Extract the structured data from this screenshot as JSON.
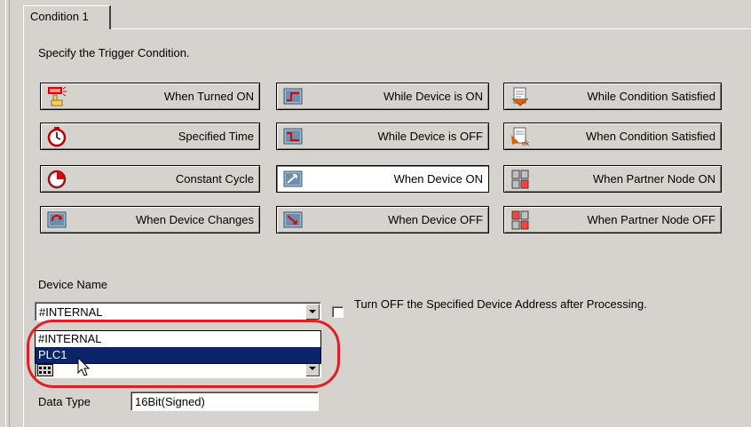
{
  "tab": {
    "label": "Condition 1"
  },
  "instruction": "Specify the Trigger Condition.",
  "trigger_buttons": {
    "when_turned_on": "When Turned ON",
    "specified_time": "Specified Time",
    "constant_cycle": "Constant Cycle",
    "when_device_changes": "When Device Changes",
    "while_device_on": "While Device is ON",
    "while_device_off": "While Device is OFF",
    "when_device_on": "When Device ON",
    "when_device_off": "When Device OFF",
    "while_condition_satisfied": "While Condition Satisfied",
    "when_condition_satisfied": "When Condition Satisfied",
    "when_partner_node_on": "When Partner Node ON",
    "when_partner_node_off": "When Partner Node OFF",
    "selected": "When Device ON"
  },
  "device_name": {
    "label": "Device Name",
    "value": "#INTERNAL",
    "options": [
      "#INTERNAL",
      "PLC1"
    ],
    "highlighted_option": "PLC1"
  },
  "turn_off_checkbox": {
    "label": "Turn OFF the Specified Device Address after Processing.",
    "checked": false
  },
  "data_type": {
    "label": "Data Type",
    "value": "16Bit(Signed)"
  },
  "colors": {
    "highlight_ellipse": "#e31e24",
    "selection": "#0a246a"
  }
}
